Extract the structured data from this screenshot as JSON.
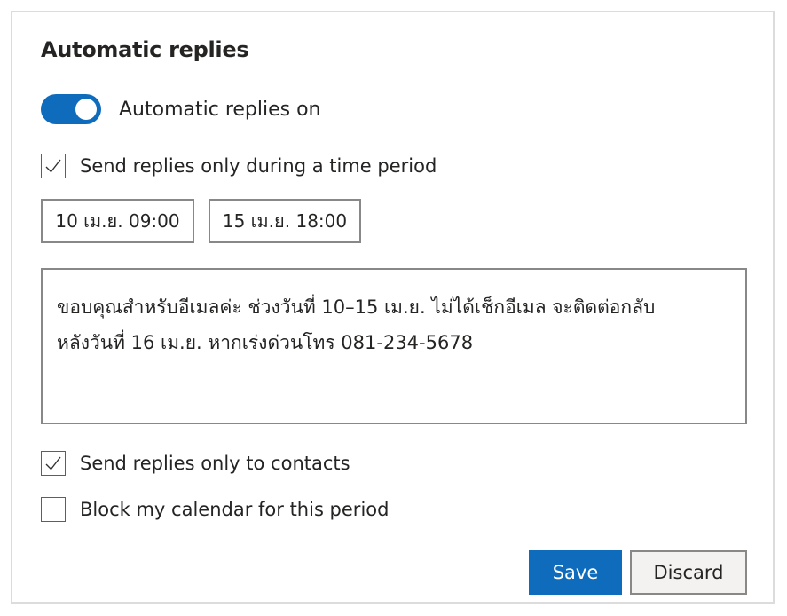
{
  "title": "Automatic replies",
  "toggle": {
    "label": "Automatic replies on",
    "on": true
  },
  "options": {
    "time_period": {
      "label": "Send replies only during a time period",
      "checked": true
    },
    "contacts_only": {
      "label": "Send replies only to contacts",
      "checked": true
    },
    "block_calendar": {
      "label": "Block my calendar for this period",
      "checked": false
    }
  },
  "dates": {
    "start": "10 เม.ย. 09:00",
    "end": "15 เม.ย. 18:00"
  },
  "message": {
    "line1": "ขอบคุณสำหรับอีเมลค่ะ ช่วงวันที่ 10–15 เม.ย. ไม่ได้เช็กอีเมล จะติดต่อกลับ",
    "line2": "หลังวันที่ 16 เม.ย. หากเร่งด่วนโทร 081-234-5678"
  },
  "buttons": {
    "save": "Save",
    "discard": "Discard"
  },
  "colors": {
    "accent": "#0f6cbd",
    "text": "#252423",
    "border": "#8a8886"
  },
  "icons": {
    "check": "checkmark-icon"
  }
}
